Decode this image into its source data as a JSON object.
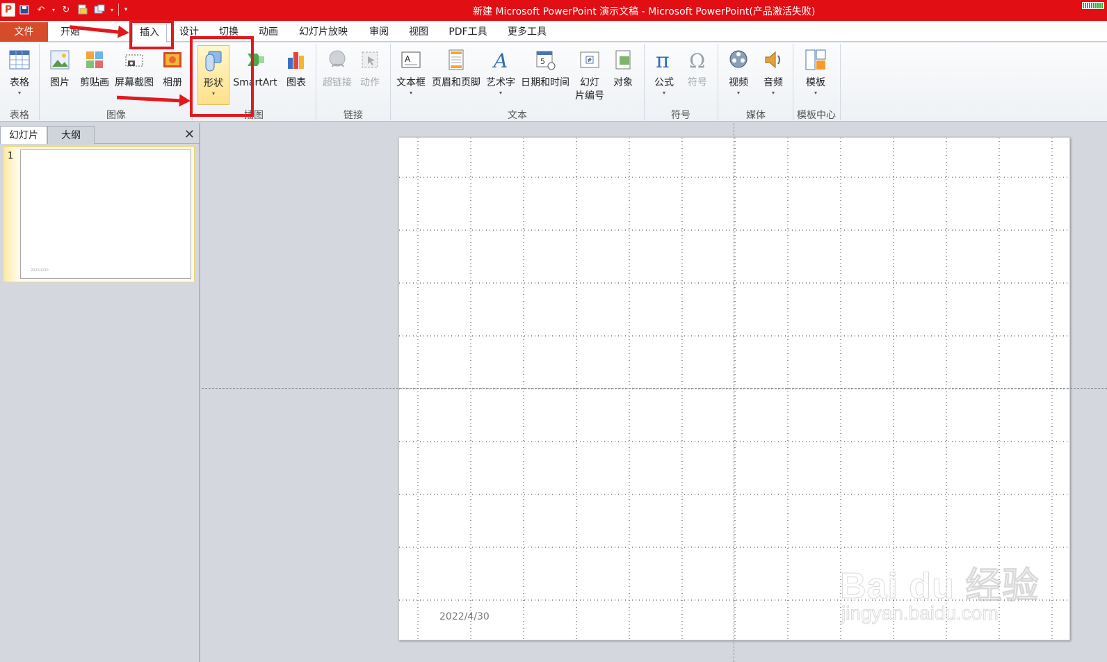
{
  "titlebar": {
    "title": "新建 Microsoft PowerPoint 演示文稿 - Microsoft PowerPoint(产品激活失败)",
    "app_icon": "P",
    "color": "#e10e14"
  },
  "tabs": {
    "file": "文件",
    "home": "开始",
    "insert": "插入",
    "design": "设计",
    "transitions": "切换",
    "animations": "动画",
    "slideshow": "幻灯片放映",
    "review": "审阅",
    "view": "视图",
    "pdf": "PDF工具",
    "more": "更多工具"
  },
  "ribbon": {
    "table": "表格",
    "picture": "图片",
    "clipart": "剪贴画",
    "screenshot": "屏幕截图",
    "album": "相册",
    "shapes": "形状",
    "smartart": "SmartArt",
    "chart": "图表",
    "hyperlink": "超链接",
    "action": "动作",
    "textbox": "文本框",
    "header_footer": "页眉和页脚",
    "wordart": "艺术字",
    "datetime": "日期和时间",
    "slide_number_1": "幻灯",
    "slide_number_2": "片编号",
    "object": "对象",
    "equation": "公式",
    "symbol": "符号",
    "video": "视频",
    "audio": "音频",
    "template": "模板",
    "groups": {
      "tables": "表格",
      "images": "图像",
      "illustrations": "插图",
      "links": "链接",
      "text": "文本",
      "symbols": "符号",
      "media": "媒体",
      "template_center": "模板中心"
    }
  },
  "panel": {
    "tab_slides": "幻灯片",
    "tab_outline": "大纲",
    "close": "✕",
    "slide_number": "1",
    "thumb_date": "2022/4/30"
  },
  "slide": {
    "date": "2022/4/30"
  },
  "watermark": {
    "logo": "Bai du 经验",
    "url": "jingyan.baidu.com"
  },
  "colors": {
    "annotation": "#e0191e",
    "file_tab": "#d64b2a"
  }
}
